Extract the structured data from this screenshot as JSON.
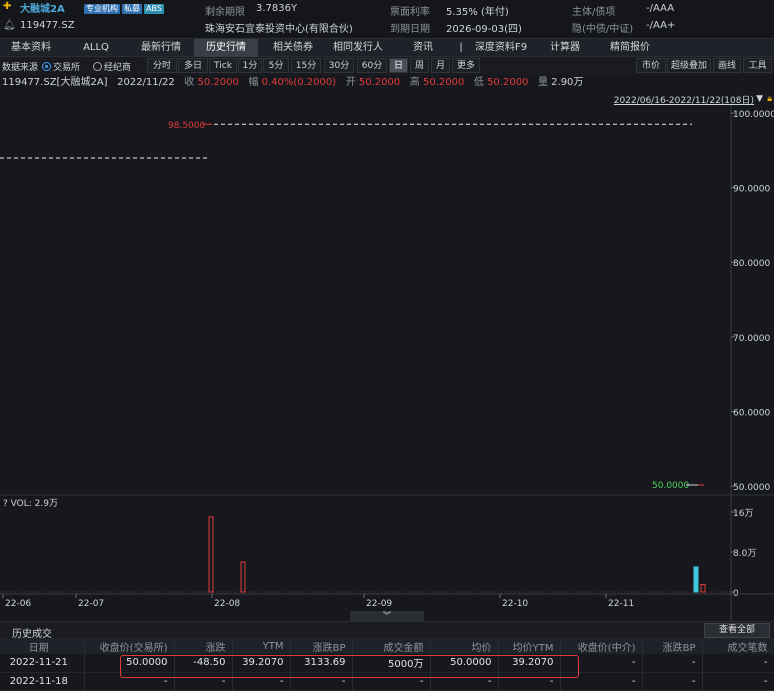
{
  "header": {
    "name": "大融城2A",
    "tags": [
      "专业机构",
      "私募",
      "ABS"
    ],
    "code": "119477.SZ",
    "remaining_label": "剩余期限",
    "remaining_value": "3.7836Y",
    "issuer": "珠海安石宜泰投资中心(有限合伙)",
    "coupon_label": "票面利率",
    "coupon_value": "5.35% (年付)",
    "maturity_label": "到期日期",
    "maturity_value": "2026-09-03(四)",
    "rating_label": "主体/债项",
    "rating_value": "-/AAA",
    "implied_label": "隐(中债/中证)",
    "implied_value": "-/AA+"
  },
  "tabs": [
    {
      "label": "基本资料"
    },
    {
      "label": "ALLQ"
    },
    {
      "label": "最新行情"
    },
    {
      "label": "历史行情"
    },
    {
      "label": "相关债券"
    },
    {
      "label": "相同发行人"
    },
    {
      "label": "资讯"
    },
    {
      "label": "|"
    },
    {
      "label": "深度资料F9"
    },
    {
      "label": "计算器"
    },
    {
      "label": "精简报价"
    }
  ],
  "toolbar": {
    "source_label": "数据来源",
    "source_exchange": "交易所",
    "source_broker": "经纪商",
    "periods": [
      "分时",
      "多日",
      "Tick",
      "1分",
      "5分",
      "15分",
      "30分",
      "60分",
      "日",
      "周",
      "月",
      "更多"
    ],
    "right_buttons": [
      "市价",
      "超级叠加",
      "画线",
      "工具"
    ]
  },
  "quote": {
    "prefix": "119477.SZ[大融城2A]",
    "date": "2022/11/22",
    "close_label": "收",
    "close": "50.2000",
    "change_label": "幅",
    "change": "0.40%(0.2000)",
    "open_label": "开",
    "open": "50.2000",
    "high_label": "高",
    "high": "50.2000",
    "low_label": "低",
    "low": "50.2000",
    "vol_label": "量",
    "vol": "2.90万"
  },
  "chart_data": {
    "type": "line",
    "range_label": "2022/06/16-2022/11/22(108日)",
    "y_ticks": [
      "100.0000",
      "90.0000",
      "80.0000",
      "70.0000",
      "60.0000",
      "50.0000"
    ],
    "ylim": [
      50,
      100
    ],
    "high_marker": "98.5000",
    "low_marker": "50.0000",
    "vol_label": "VOL: 2.9万",
    "vol_ticks": [
      "16万",
      "8.0万",
      "0"
    ],
    "x_ticks": [
      "22-06",
      "22-07",
      "22-08",
      "22-09",
      "22-10",
      "22-11"
    ],
    "volumes": [
      {
        "date": "22-07-26",
        "value": 15
      },
      {
        "date": "22-08-03",
        "value": 6
      },
      {
        "date": "22-11-21",
        "value": 5
      },
      {
        "date": "22-11-22",
        "value": 1.5
      }
    ]
  },
  "history": {
    "title": "历史成交",
    "view_all": "查看全部",
    "columns": [
      "日期",
      "收盘价(交易所)",
      "涨跌",
      "YTM",
      "涨跌BP",
      "成交金额",
      "均价",
      "均价YTM",
      "收盘价(中介)",
      "涨跌BP",
      "成交笔数"
    ],
    "rows": [
      [
        "2022-11-21",
        "50.0000",
        "-48.50",
        "39.2070",
        "3133.69",
        "5000万",
        "50.0000",
        "39.2070",
        "-",
        "-",
        "-"
      ],
      [
        "2022-11-18",
        "-",
        "-",
        "-",
        "-",
        "-",
        "-",
        "-",
        "-",
        "-",
        "-"
      ]
    ]
  },
  "colors": {
    "accent": "#4ea8d8",
    "up": "#e03b3b",
    "vol_up_fill": "#3fc6d8"
  }
}
